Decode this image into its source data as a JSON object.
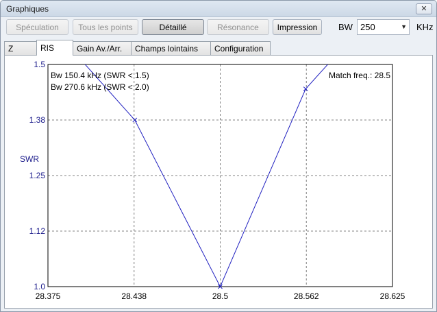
{
  "window": {
    "title": "Graphiques",
    "close_label": "✕"
  },
  "toolbar": {
    "buttons": [
      {
        "label": "Spéculation",
        "state": "disabled"
      },
      {
        "label": "Tous les points",
        "state": "disabled"
      },
      {
        "label": "Détaillé",
        "state": "active"
      },
      {
        "label": "Résonance",
        "state": "disabled"
      },
      {
        "label": "Impression",
        "state": "enabled"
      }
    ],
    "bw_label": "BW",
    "bw_value": "250",
    "bw_unit": "KHz"
  },
  "tabs": [
    {
      "label": "Z"
    },
    {
      "label": "RIS",
      "selected": true
    },
    {
      "label": "Gain Av./Arr."
    },
    {
      "label": "Champs lointains"
    },
    {
      "label": "Configuration"
    }
  ],
  "colors": {
    "curve": "#2020c0",
    "axis_label": "#1a1a8a",
    "grid": "#808080"
  },
  "chart_data": {
    "type": "line",
    "ylabel": "SWR",
    "x_ticks": [
      "28.375",
      "28.438",
      "28.5",
      "28.562",
      "28.625"
    ],
    "y_ticks": [
      "1.5",
      "1.38",
      "1.25",
      "1.12",
      "1.0"
    ],
    "xlim": [
      28.375,
      28.625
    ],
    "ylim": [
      1.0,
      1.5
    ],
    "annotations": [
      "Bw 150.4 kHz (SWR < 1.5)",
      "Bw 270.6 kHz (SWR < 2.0)",
      "Match freq.: 28.5"
    ],
    "series": [
      {
        "x": [
          28.402,
          28.438,
          28.5,
          28.562,
          28.578
        ],
        "y": [
          1.5,
          1.375,
          1.0,
          1.445,
          1.5
        ]
      }
    ],
    "markers": [
      {
        "x": 28.438,
        "y": 1.375
      },
      {
        "x": 28.5,
        "y": 1.0
      },
      {
        "x": 28.562,
        "y": 1.445
      }
    ],
    "grid": true
  }
}
